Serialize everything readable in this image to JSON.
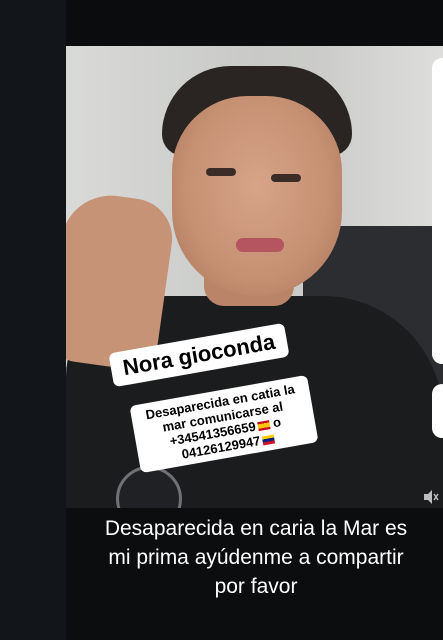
{
  "photo": {
    "sticker_name": "Nora gioconda",
    "sticker_info_line1": "Desaparecida en catia la",
    "sticker_info_line2": "mar comunicarse al",
    "sticker_info_phone1": "+34541356659",
    "sticker_info_or": "o",
    "sticker_info_phone2": "04126129947"
  },
  "caption": {
    "line1": "Desaparecida en caria la Mar es",
    "line2": "mi prima ayúdenme a compartir",
    "line3": "por favor"
  },
  "icons": {
    "volume": "speaker-muted-icon",
    "flag_es": "spain-flag-icon",
    "flag_ve": "venezuela-flag-icon"
  },
  "colors": {
    "background": "#0b0d0f",
    "sticker_bg": "#ffffff",
    "caption_text": "#ffffff"
  }
}
